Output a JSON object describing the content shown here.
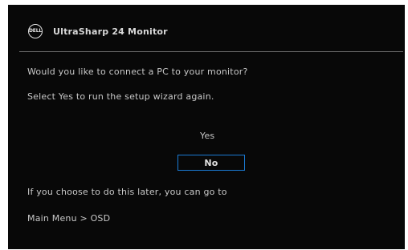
{
  "window": {
    "logo_text": "DELL",
    "title": "UltraSharp 24 Monitor"
  },
  "dialog": {
    "question": "Would you like to connect a PC to your monitor?",
    "instruction": "Select Yes to run the setup wizard again.",
    "options": {
      "yes_label": "Yes",
      "no_label": "No"
    },
    "hint": "If you choose to do this later, you can go to",
    "menu_path": "Main Menu > OSD"
  },
  "colors": {
    "background": "#080808",
    "text": "#c8c8c8",
    "selection_border": "#1a7ad4",
    "divider": "#6e6e6e"
  },
  "icons": {
    "logo": "dell-logo-icon"
  }
}
